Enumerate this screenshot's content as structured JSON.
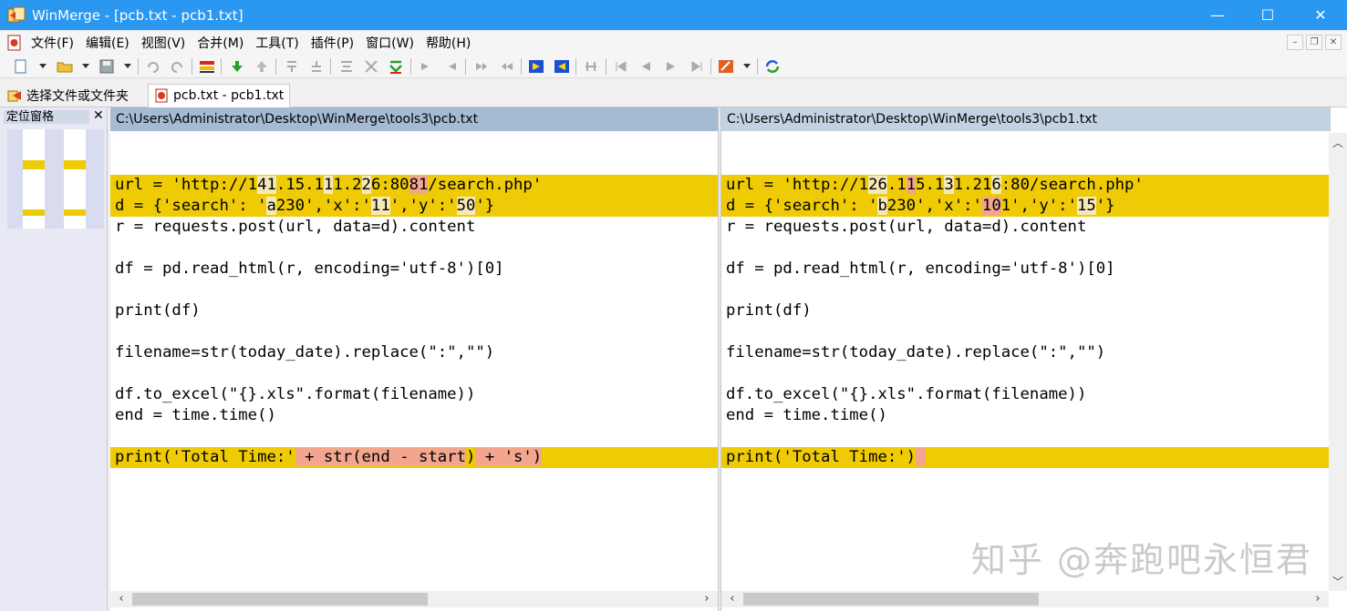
{
  "window": {
    "title": "WinMerge - [pcb.txt - pcb1.txt]",
    "minimize": "—",
    "maximize": "☐",
    "close": "✕"
  },
  "menu": {
    "items": [
      "文件(F)",
      "编辑(E)",
      "视图(V)",
      "合并(M)",
      "工具(T)",
      "插件(P)",
      "窗口(W)",
      "帮助(H)"
    ],
    "mdi_minimize": "–",
    "mdi_restore": "❐",
    "mdi_close": "✕"
  },
  "tabs": [
    {
      "label": "选择文件或文件夹"
    },
    {
      "label": "pcb.txt - pcb1.txt"
    }
  ],
  "location_pane": {
    "title": "定位窗格",
    "close": "✕"
  },
  "left_pane": {
    "path": "C:\\Users\\Administrator\\Desktop\\WinMerge\\tools3\\pcb.txt",
    "lines": [
      {
        "diff": false,
        "parts": [
          {
            "t": "",
            "s": ""
          }
        ]
      },
      {
        "diff": true,
        "parts": [
          {
            "t": "url = 'http://1",
            "s": ""
          },
          {
            "t": "41",
            "s": "mv"
          },
          {
            "t": ".15.1",
            "s": ""
          },
          {
            "t": "1",
            "s": "mv"
          },
          {
            "t": "1.2",
            "s": ""
          },
          {
            "t": "2",
            "s": "mv"
          },
          {
            "t": "6:80",
            "s": ""
          },
          {
            "t": "81",
            "s": "hl"
          },
          {
            "t": "/search.php'",
            "s": ""
          }
        ]
      },
      {
        "diff": true,
        "parts": [
          {
            "t": "d = {'search': '",
            "s": ""
          },
          {
            "t": "a",
            "s": "mv"
          },
          {
            "t": "230','x':'",
            "s": ""
          },
          {
            "t": "11",
            "s": "mv"
          },
          {
            "t": "','y':'",
            "s": ""
          },
          {
            "t": "50",
            "s": "mv"
          },
          {
            "t": "'}",
            "s": ""
          }
        ]
      },
      {
        "diff": false,
        "parts": [
          {
            "t": "r = requests.post(url, data=d).content",
            "s": ""
          }
        ]
      },
      {
        "diff": false,
        "parts": [
          {
            "t": "",
            "s": ""
          }
        ]
      },
      {
        "diff": false,
        "parts": [
          {
            "t": "df = pd.read_html(r, encoding='utf-8')[0]",
            "s": ""
          }
        ]
      },
      {
        "diff": false,
        "parts": [
          {
            "t": "",
            "s": ""
          }
        ]
      },
      {
        "diff": false,
        "parts": [
          {
            "t": "print(df)",
            "s": ""
          }
        ]
      },
      {
        "diff": false,
        "parts": [
          {
            "t": "",
            "s": ""
          }
        ]
      },
      {
        "diff": false,
        "parts": [
          {
            "t": "filename=str(today_date).replace(\":\",\"\")",
            "s": ""
          }
        ]
      },
      {
        "diff": false,
        "parts": [
          {
            "t": "",
            "s": ""
          }
        ]
      },
      {
        "diff": false,
        "parts": [
          {
            "t": "df.to_excel(\"{}.xls\".format(filename))",
            "s": ""
          }
        ]
      },
      {
        "diff": false,
        "parts": [
          {
            "t": "end = time.time()",
            "s": ""
          }
        ]
      },
      {
        "diff": false,
        "parts": [
          {
            "t": "",
            "s": ""
          }
        ]
      },
      {
        "diff": true,
        "parts": [
          {
            "t": "print('Total Time:'",
            "s": ""
          },
          {
            "t": " + str(end - start",
            "s": "hl"
          },
          {
            "t": ")",
            "s": ""
          },
          {
            "t": " + 's')",
            "s": "hl"
          }
        ]
      }
    ]
  },
  "right_pane": {
    "path": "C:\\Users\\Administrator\\Desktop\\WinMerge\\tools3\\pcb1.txt",
    "lines": [
      {
        "diff": false,
        "parts": [
          {
            "t": "",
            "s": ""
          }
        ]
      },
      {
        "diff": true,
        "parts": [
          {
            "t": "url = 'http://1",
            "s": ""
          },
          {
            "t": "26",
            "s": "mv"
          },
          {
            "t": ".1",
            "s": ""
          },
          {
            "t": "1",
            "s": "hl"
          },
          {
            "t": "5.1",
            "s": ""
          },
          {
            "t": "3",
            "s": "mv"
          },
          {
            "t": "1.21",
            "s": ""
          },
          {
            "t": "6",
            "s": "mv"
          },
          {
            "t": ":80/search.php'",
            "s": ""
          }
        ]
      },
      {
        "diff": true,
        "parts": [
          {
            "t": "d = {'search': '",
            "s": ""
          },
          {
            "t": "b",
            "s": "mv"
          },
          {
            "t": "230','x':'",
            "s": ""
          },
          {
            "t": "10",
            "s": "hl"
          },
          {
            "t": "1','y':'",
            "s": ""
          },
          {
            "t": "15",
            "s": "mv"
          },
          {
            "t": "'}",
            "s": ""
          }
        ]
      },
      {
        "diff": false,
        "parts": [
          {
            "t": "r = requests.post(url, data=d).content",
            "s": ""
          }
        ]
      },
      {
        "diff": false,
        "parts": [
          {
            "t": "",
            "s": ""
          }
        ]
      },
      {
        "diff": false,
        "parts": [
          {
            "t": "df = pd.read_html(r, encoding='utf-8')[0]",
            "s": ""
          }
        ]
      },
      {
        "diff": false,
        "parts": [
          {
            "t": "",
            "s": ""
          }
        ]
      },
      {
        "diff": false,
        "parts": [
          {
            "t": "print(df)",
            "s": ""
          }
        ]
      },
      {
        "diff": false,
        "parts": [
          {
            "t": "",
            "s": ""
          }
        ]
      },
      {
        "diff": false,
        "parts": [
          {
            "t": "filename=str(today_date).replace(\":\",\"\")",
            "s": ""
          }
        ]
      },
      {
        "diff": false,
        "parts": [
          {
            "t": "",
            "s": ""
          }
        ]
      },
      {
        "diff": false,
        "parts": [
          {
            "t": "df.to_excel(\"{}.xls\".format(filename))",
            "s": ""
          }
        ]
      },
      {
        "diff": false,
        "parts": [
          {
            "t": "end = time.time()",
            "s": ""
          }
        ]
      },
      {
        "diff": false,
        "parts": [
          {
            "t": "",
            "s": ""
          }
        ]
      },
      {
        "diff": true,
        "parts": [
          {
            "t": "print('Total Time:')",
            "s": ""
          },
          {
            "t": " ",
            "s": "hl"
          }
        ]
      }
    ]
  },
  "scroll": {
    "left": "‹",
    "right": "›",
    "up": "︿",
    "down": "﹀"
  },
  "watermark": "知乎 @奔跑吧永恒君",
  "colors": {
    "title_bar": "#2a97f0",
    "diff_line": "#efcb05",
    "word_diff": "#f3a58e",
    "header_left": "#a5bad3",
    "header_right": "#c3d1e2"
  }
}
